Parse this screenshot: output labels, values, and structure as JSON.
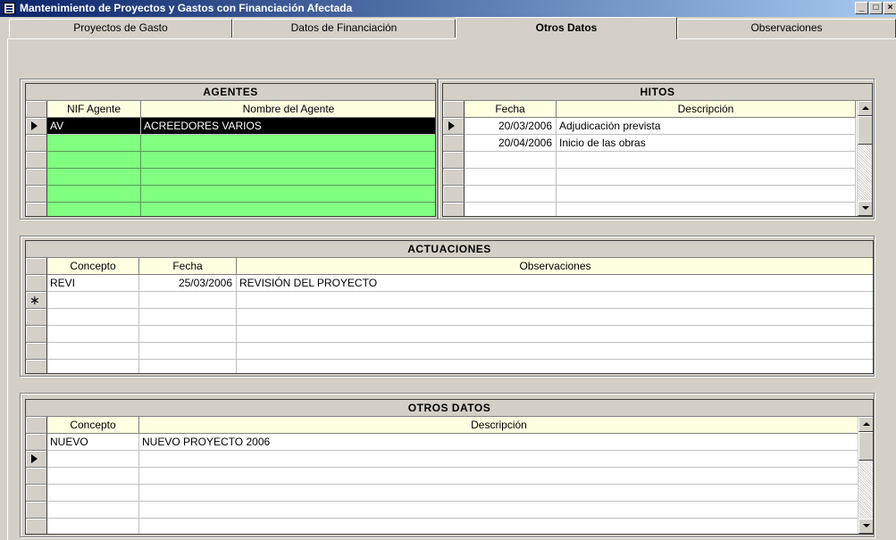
{
  "window": {
    "title": "Mantenimiento de Proyectos y Gastos con Financiación Afectada"
  },
  "tabs": [
    {
      "label": "Proyectos de Gasto"
    },
    {
      "label": "Datos de Financiación"
    },
    {
      "label": "Otros Datos",
      "active": true
    },
    {
      "label": "Observaciones"
    }
  ],
  "agentes": {
    "title": "AGENTES",
    "columns": [
      "NIF Agente",
      "Nombre del Agente"
    ],
    "rows": [
      {
        "nif": "AV",
        "nombre": "ACREEDORES VARIOS"
      }
    ],
    "row_highlight_color": "#80ff80",
    "selected_color": "#000000"
  },
  "hitos": {
    "title": "HITOS",
    "columns": [
      "Fecha",
      "Descripción"
    ],
    "rows": [
      {
        "fecha": "20/03/2006",
        "descripcion": "Adjudicación prevista"
      },
      {
        "fecha": "20/04/2006",
        "descripcion": "Inicio de las obras"
      }
    ]
  },
  "actuaciones": {
    "title": "ACTUACIONES",
    "columns": [
      "Concepto",
      "Fecha",
      "Observaciones"
    ],
    "rows": [
      {
        "concepto": "REVI",
        "fecha": "25/03/2006",
        "observaciones": "REVISIÓN DEL PROYECTO"
      }
    ]
  },
  "otros_datos": {
    "title": "OTROS DATOS",
    "columns": [
      "Concepto",
      "Descripción"
    ],
    "rows": [
      {
        "concepto": "NUEVO",
        "descripcion": "NUEVO PROYECTO 2006"
      }
    ]
  },
  "icons": {
    "app": "form-icon",
    "row_pointer": "row-pointer-icon",
    "new_row": "new-row-star-icon",
    "scroll_up": "scroll-up-arrow-icon",
    "scroll_down": "scroll-down-arrow-icon"
  }
}
